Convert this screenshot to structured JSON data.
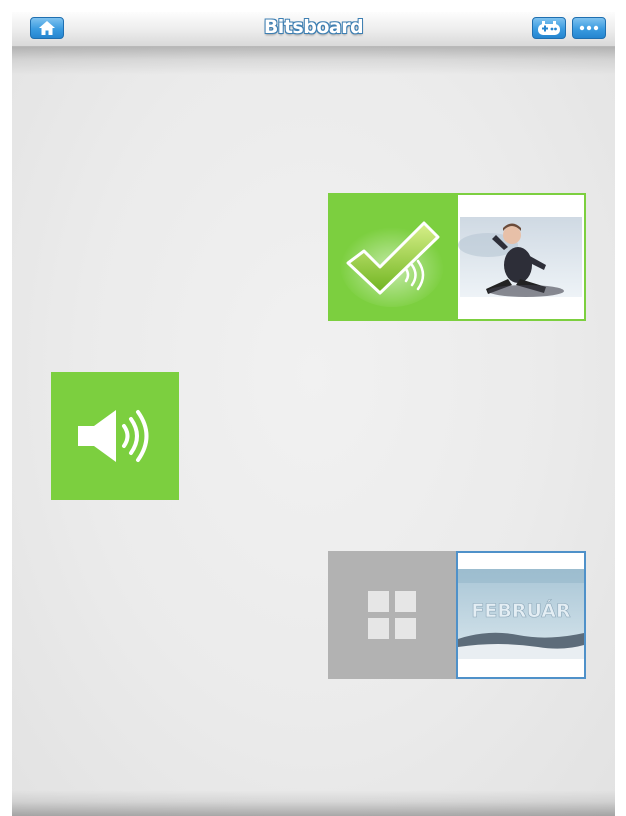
{
  "header": {
    "title": "Bitsboard",
    "home_icon": "home-icon",
    "game_icon": "game-controller-icon",
    "more_icon": "more-icon"
  },
  "board": {
    "correct_card": {
      "status_icon": "checkmark-icon",
      "image": "photo-child-sledding"
    },
    "sound_button": {
      "icon": "speaker-icon"
    },
    "february_card": {
      "grid_icon": "grid-icon",
      "image_text": "FEBRUÁR"
    }
  },
  "colors": {
    "green": "#7ccf3f",
    "gray_tile": "#b2b2b2",
    "blue_button": "#3a9be0",
    "blue_border": "#4f91c9"
  }
}
